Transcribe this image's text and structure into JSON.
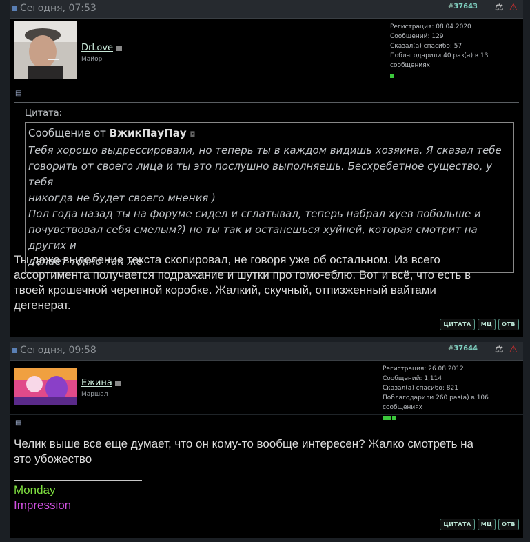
{
  "posts": [
    {
      "date": "Сегодня, 07:53",
      "number_prefix": "#",
      "number": "37643",
      "username": "DrLove",
      "rank": "Майор",
      "stats": {
        "registration": "Регистрация: 08.04.2020",
        "messages": "Сообщений: 129",
        "thanks_said": "Сказал(а) спасибо: 57",
        "thanked": "Поблагодарили 40 раз(а) в 13 сообщениях"
      },
      "reputation_pips": 1,
      "quote": {
        "label": "Цитата:",
        "from_prefix": "Сообщение от",
        "from_user": "ВжикПауПау",
        "text": [
          "Тебя хорошо выдрессировали, но теперь ты в каждом видишь хозяина. Я сказал тебе",
          "говорить от своего лица и ты это послушно выполняешь. Бесхребетное существо, у тебя",
          "никогда не будет своего мнения )",
          "Пол года назад ты на форуме сидел и сглатывал, теперь набрал хуев побольше и",
          "почувствовал себя смелым?) но ты так и останешься хуйней, которая смотрит на других и",
          "делает точно так же"
        ]
      },
      "message": [
        "Ты даже выделение текста скопировал, не говоря уже об остальном. Из всего",
        "ассортимента получается подражание и шутки про гомо-еблю. Вот и всё, что есть в",
        "твоей крошечной черепной коробке. Жалкий, скучный, отпизженный вайтами",
        "дегенерат."
      ]
    },
    {
      "date": "Сегодня, 09:58",
      "number_prefix": "#",
      "number": "37644",
      "username": "Ежина",
      "rank": "Маршал",
      "stats": {
        "registration": "Регистрация: 26.08.2012",
        "messages": "Сообщений: 1,114",
        "thanks_said": "Сказал(а) спасибо: 821",
        "thanked": "Поблагодарили 260 раз(а) в 106 сообщениях"
      },
      "reputation_pips": 3,
      "message": [
        "Челик выше все еще думает, что он кому-то вообще интересен? Жалко смотреть на",
        "это убожество"
      ],
      "signature": {
        "line1": "Monday",
        "line2": "Impression"
      }
    }
  ],
  "buttons": {
    "quote": "Цитата",
    "multiquote": "мц",
    "reply": "Отв"
  },
  "icons": {
    "date_icon": "post-dot-icon",
    "scales_icon": "scales-icon",
    "warning_icon": "warning-icon",
    "document_icon": "document-icon",
    "status_icon": "offline-status-icon"
  },
  "colors": {
    "background": "#1b1f24",
    "post_bg": "#000000",
    "accent": "#7fd0c0",
    "signature_green": "#7fe040",
    "signature_purple": "#d050e0"
  }
}
